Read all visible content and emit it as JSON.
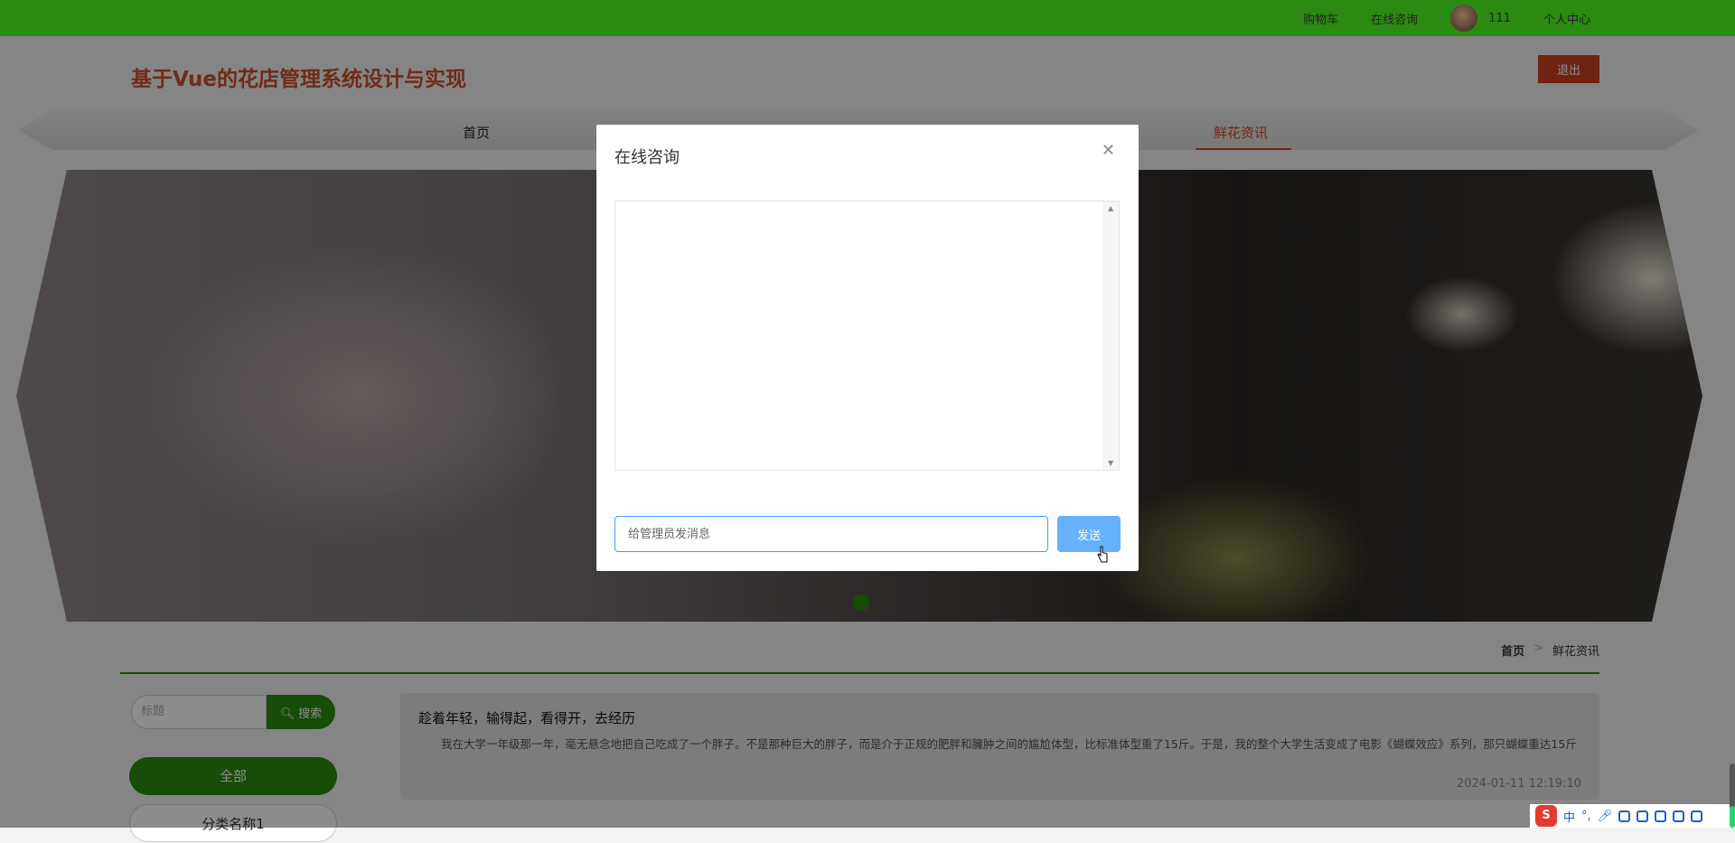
{
  "topbar": {
    "cart": "购物车",
    "consult": "在线咨询",
    "username": "111",
    "profile": "个人中心"
  },
  "header": {
    "title": "基于Vue的花店管理系统设计与实现",
    "logout": "退出"
  },
  "nav": {
    "home": "首页",
    "news": "鲜花资讯"
  },
  "breadcrumb": {
    "home": "首页",
    "sep": ">",
    "current": "鲜花资讯"
  },
  "sidebar": {
    "search_placeholder": "标题",
    "search_button": "搜索",
    "categories": [
      "全部",
      "分类名称1"
    ]
  },
  "article": {
    "title": "趁着年轻，输得起，看得开，去经历",
    "summary": "我在大学一年级那一年，毫无悬念地把自己吃成了一个胖子。不是那种巨大的胖子，而是介于正规的肥胖和臃肿之间的尴尬体型，比标准体型重了15斤。于是，我的整个大学生活变成了电影《蝴蝶效应》系列，那只蝴蝶重达15斤",
    "date": "2024-01-11 12:19:10"
  },
  "modal": {
    "title": "在线咨询",
    "input_placeholder": "给管理员发消息",
    "input_value": "",
    "send": "发送"
  },
  "tray": {
    "ime": "中",
    "punct": "°,"
  },
  "colors": {
    "primary_green": "#2a8a12",
    "title_red": "#c8512f",
    "send_blue": "#66b1ff",
    "input_border": "#409eff"
  }
}
